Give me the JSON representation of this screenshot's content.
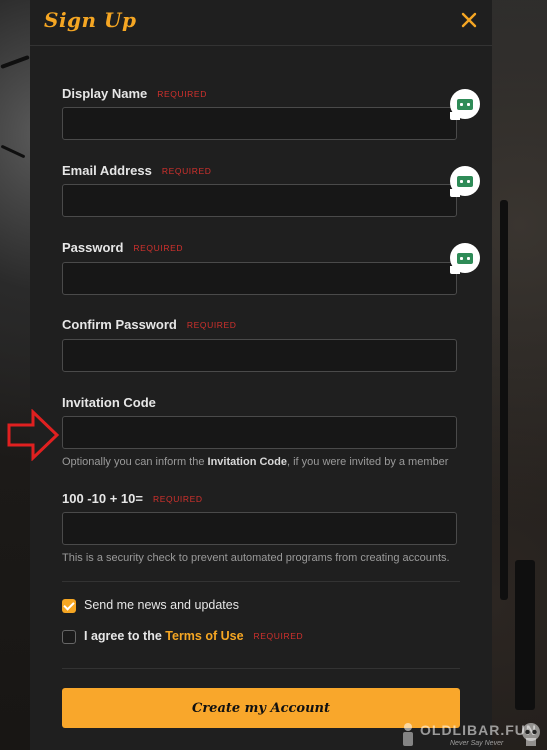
{
  "header": {
    "title": "Sign Up",
    "close_icon": "close-icon"
  },
  "required_text": "REQUIRED",
  "fields": {
    "display_name": {
      "label": "Display Name",
      "value": ""
    },
    "email": {
      "label": "Email Address",
      "value": ""
    },
    "password": {
      "label": "Password",
      "value": ""
    },
    "confirm_password": {
      "label": "Confirm Password",
      "value": ""
    },
    "invitation_code": {
      "label": "Invitation Code",
      "value": "",
      "help_prefix": "Optionally you can inform the ",
      "help_bold": "Invitation Code",
      "help_suffix": ", if you were invited by a member"
    },
    "captcha": {
      "label": "100 -10 + 10=",
      "value": "",
      "help": "This is a security check to prevent automated programs from creating accounts."
    }
  },
  "options": {
    "news": {
      "label": "Send me news and updates",
      "checked": true
    },
    "terms": {
      "prefix": "I agree to the ",
      "link": "Terms of Use",
      "checked": false
    }
  },
  "submit_label": "Create my Account",
  "colors": {
    "accent": "#f5a623",
    "required": "#d0312d",
    "annotation_arrow": "#e02020",
    "extension_icon": "#2e8b57"
  },
  "watermark": {
    "text": "OLDLIBAR.FUN",
    "sub": "Never Say Never"
  }
}
